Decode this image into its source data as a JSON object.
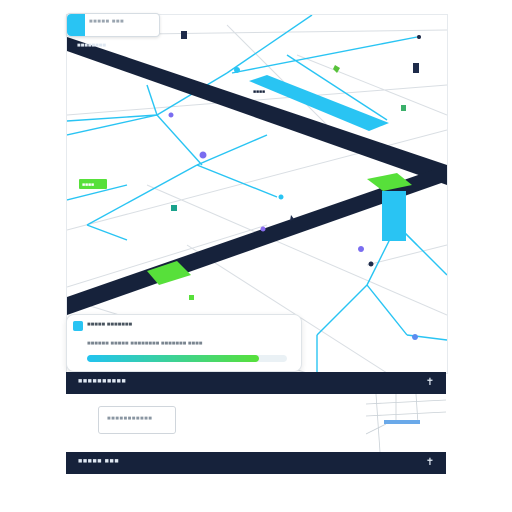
{
  "search": {
    "text": "■■■■■ ■■■"
  },
  "map": {
    "road_label_main": "■■■■■■■■",
    "highlight_label": "■■■■",
    "green_label": "■■■■",
    "colors": {
      "road_dark": "#16223b",
      "route_cyan": "#29c4f3",
      "route_green": "#57e03a",
      "minor_road": "#d9dee3",
      "pin_purple": "#7a6df0",
      "pin_dark": "#1e2b4a"
    }
  },
  "info_card": {
    "title": "■■■■■ ■■■■■■■",
    "subtitle": "■■■■■■ ■■■■■ ■■■■■■■■ ■■■■■■■ ■■■■",
    "progress": 0.86
  },
  "bar1": {
    "label": "■■■■■■■■■■",
    "icon": "pin-icon"
  },
  "mid": {
    "box_label": "■■■■■■■■■■■"
  },
  "bar2": {
    "label": "■■■■■ ■■■",
    "icon": "pin-icon"
  }
}
